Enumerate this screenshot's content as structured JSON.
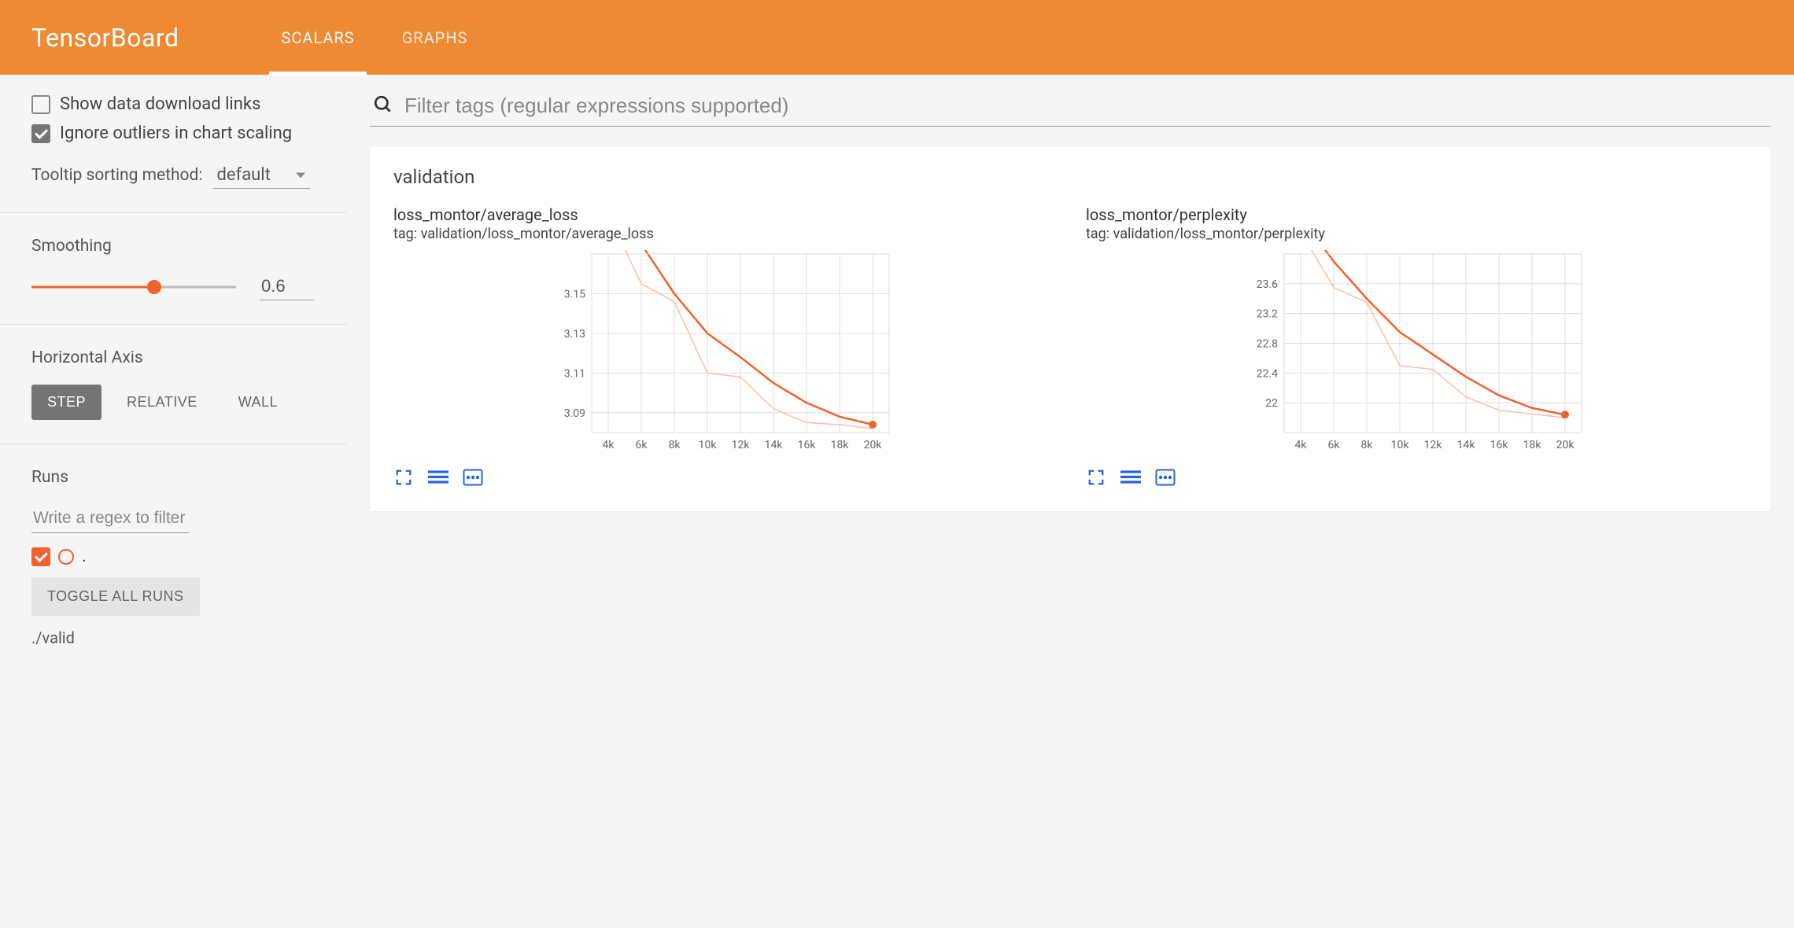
{
  "header": {
    "brand": "TensorBoard",
    "tabs": [
      {
        "label": "SCALARS",
        "active": true
      },
      {
        "label": "GRAPHS",
        "active": false
      }
    ]
  },
  "sidebar": {
    "show_download_links": {
      "label": "Show data download links",
      "checked": false
    },
    "ignore_outliers": {
      "label": "Ignore outliers in chart scaling",
      "checked": true
    },
    "tooltip_sort": {
      "label": "Tooltip sorting method:",
      "value": "default"
    },
    "smoothing": {
      "label": "Smoothing",
      "value": "0.6",
      "pct": 60
    },
    "horizontal_axis": {
      "label": "Horizontal Axis",
      "options": [
        {
          "label": "STEP",
          "active": true
        },
        {
          "label": "RELATIVE",
          "active": false
        },
        {
          "label": "WALL",
          "active": false
        }
      ]
    },
    "runs": {
      "label": "Runs",
      "filter_placeholder": "Write a regex to filter r…",
      "run_symbol": ".",
      "toggle_all_label": "TOGGLE ALL RUNS",
      "run_name": "./valid"
    }
  },
  "content": {
    "filter_placeholder": "Filter tags (regular expressions supported)",
    "panel_title": "validation"
  },
  "chart_data": [
    {
      "type": "line",
      "title": "loss_montor/average_loss",
      "tag": "tag: validation/loss_montor/average_loss",
      "xlabel": "",
      "ylabel": "",
      "xlim": [
        3000,
        21000
      ],
      "ylim": [
        3.08,
        3.17
      ],
      "x_ticks": [
        4000,
        6000,
        8000,
        10000,
        12000,
        14000,
        16000,
        18000,
        20000
      ],
      "x_tick_labels": [
        "4k",
        "6k",
        "8k",
        "10k",
        "12k",
        "14k",
        "16k",
        "18k",
        "20k"
      ],
      "y_ticks": [
        3.09,
        3.11,
        3.13,
        3.15
      ],
      "series": [
        {
          "name": "smoothed",
          "style": "main",
          "x": [
            4000,
            6000,
            8000,
            10000,
            12000,
            14000,
            16000,
            18000,
            20000
          ],
          "y": [
            3.2,
            3.175,
            3.15,
            3.13,
            3.118,
            3.105,
            3.095,
            3.088,
            3.084
          ]
        },
        {
          "name": "raw",
          "style": "light",
          "x": [
            4000,
            6000,
            8000,
            10000,
            12000,
            14000,
            16000,
            18000,
            20000
          ],
          "y": [
            3.19,
            3.155,
            3.146,
            3.11,
            3.108,
            3.092,
            3.085,
            3.084,
            3.082
          ]
        }
      ],
      "endpoint": {
        "x": 20000,
        "y": 3.084
      }
    },
    {
      "type": "line",
      "title": "loss_montor/perplexity",
      "tag": "tag: validation/loss_montor/perplexity",
      "xlabel": "",
      "ylabel": "",
      "xlim": [
        3000,
        21000
      ],
      "ylim": [
        21.6,
        24.0
      ],
      "x_ticks": [
        4000,
        6000,
        8000,
        10000,
        12000,
        14000,
        16000,
        18000,
        20000
      ],
      "x_tick_labels": [
        "4k",
        "6k",
        "8k",
        "10k",
        "12k",
        "14k",
        "16k",
        "18k",
        "20k"
      ],
      "y_ticks": [
        22,
        22.4,
        22.8,
        23.2,
        23.6
      ],
      "series": [
        {
          "name": "smoothed",
          "style": "main",
          "x": [
            4000,
            6000,
            8000,
            10000,
            12000,
            14000,
            16000,
            18000,
            20000
          ],
          "y": [
            24.5,
            23.9,
            23.4,
            22.95,
            22.65,
            22.35,
            22.1,
            21.93,
            21.84
          ]
        },
        {
          "name": "raw",
          "style": "light",
          "x": [
            4000,
            6000,
            8000,
            10000,
            12000,
            14000,
            16000,
            18000,
            20000
          ],
          "y": [
            24.3,
            23.55,
            23.35,
            22.5,
            22.45,
            22.08,
            21.9,
            21.85,
            21.8
          ]
        }
      ],
      "endpoint": {
        "x": 20000,
        "y": 21.84
      }
    }
  ]
}
